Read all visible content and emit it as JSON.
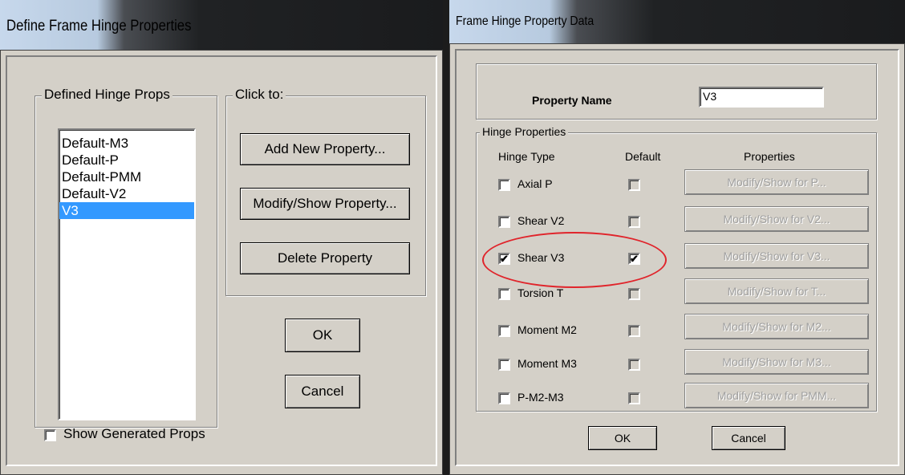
{
  "left_dialog": {
    "title": "Define Frame Hinge Properties",
    "defined_group_label": "Defined Hinge Props",
    "list_items": [
      "Default-M3",
      "Default-P",
      "Default-PMM",
      "Default-V2",
      "V3"
    ],
    "selected_item": "V3",
    "click_group_label": "Click to:",
    "add_button": "Add New Property...",
    "modify_button": "Modify/Show Property...",
    "delete_button": "Delete Property",
    "ok_button": "OK",
    "cancel_button": "Cancel",
    "show_generated_label": "Show Generated Props"
  },
  "right_dialog": {
    "title": "Frame Hinge Property Data",
    "property_name_label": "Property Name",
    "property_name_value": "V3",
    "hinge_group_label": "Hinge Properties",
    "col_hinge_type": "Hinge Type",
    "col_default": "Default",
    "col_properties": "Properties",
    "rows": [
      {
        "label": "Axial  P",
        "checked": false,
        "default_checked": false,
        "button": "Modify/Show for P..."
      },
      {
        "label": "Shear  V2",
        "checked": false,
        "default_checked": false,
        "button": "Modify/Show for V2..."
      },
      {
        "label": "Shear  V3",
        "checked": true,
        "default_checked": true,
        "button": "Modify/Show for V3..."
      },
      {
        "label": "Torsion  T",
        "checked": false,
        "default_checked": false,
        "button": "Modify/Show for T..."
      },
      {
        "label": "Moment  M2",
        "checked": false,
        "default_checked": false,
        "button": "Modify/Show for M2..."
      },
      {
        "label": "Moment  M3",
        "checked": false,
        "default_checked": false,
        "button": "Modify/Show for M3..."
      },
      {
        "label": "P-M2-M3",
        "checked": false,
        "default_checked": false,
        "button": "Modify/Show for PMM..."
      }
    ],
    "ok_button": "OK",
    "cancel_button": "Cancel"
  },
  "colors": {
    "dialog_face": "#d4d0c8",
    "selection": "#3399ff",
    "highlight_oval": "#e0242b"
  }
}
